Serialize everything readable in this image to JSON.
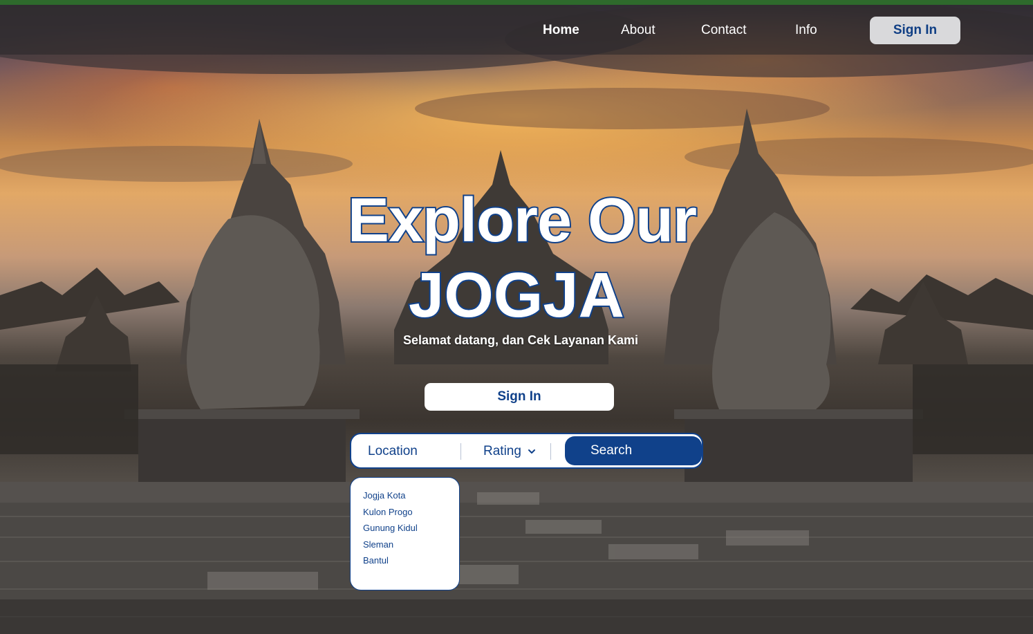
{
  "navbar": {
    "links": [
      {
        "label": "Home"
      },
      {
        "label": "About"
      },
      {
        "label": "Contact"
      },
      {
        "label": "Info"
      }
    ],
    "signin_label": "Sign In"
  },
  "hero": {
    "title_line1": "Explore Our",
    "title_line2": "JOGJA",
    "subtitle": "Selamat datang, dan Cek Layanan Kami",
    "signin_label": "Sign In"
  },
  "search": {
    "location_label": "Location",
    "rating_label": "Rating",
    "rating_icon": "chevron-down-icon",
    "search_label": "Search"
  },
  "location_options": [
    "Jogja Kota",
    "Kulon Progo",
    "Gunung Kidul",
    "Sleman",
    "Bantul"
  ],
  "colors": {
    "brand_blue": "#10418a",
    "top_strip": "#2e6a2c",
    "nav_button_bg": "#d9d9db"
  }
}
